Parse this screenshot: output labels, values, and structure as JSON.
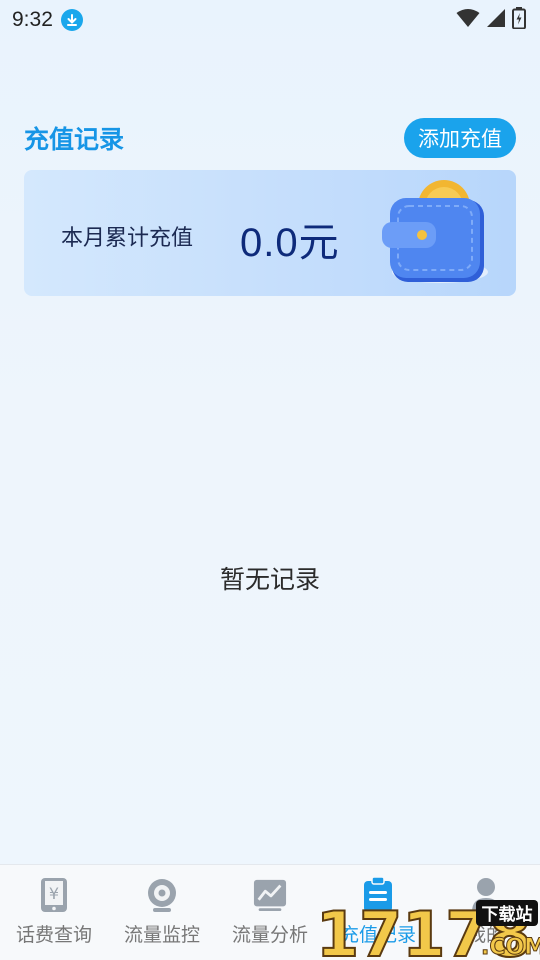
{
  "status_bar": {
    "time": "9:32"
  },
  "header": {
    "title": "充值记录",
    "add_button": "添加充值"
  },
  "summary": {
    "label": "本月累计充值",
    "value": "0.0元"
  },
  "empty_state": {
    "text": "暂无记录"
  },
  "bottom_nav": {
    "active_index": 3,
    "items": [
      {
        "label": "话费查询",
        "icon": "phone-bill-icon"
      },
      {
        "label": "流量监控",
        "icon": "monitor-icon"
      },
      {
        "label": "流量分析",
        "icon": "chart-icon"
      },
      {
        "label": "充值记录",
        "icon": "clipboard-icon"
      },
      {
        "label": "我的",
        "icon": "person-icon"
      }
    ]
  },
  "watermark": {
    "text": "17178",
    "sub": "下载站",
    "domain": ".COM"
  },
  "colors": {
    "accent": "#1aa3ec",
    "title": "#1695e6",
    "value": "#0e2a7a"
  }
}
